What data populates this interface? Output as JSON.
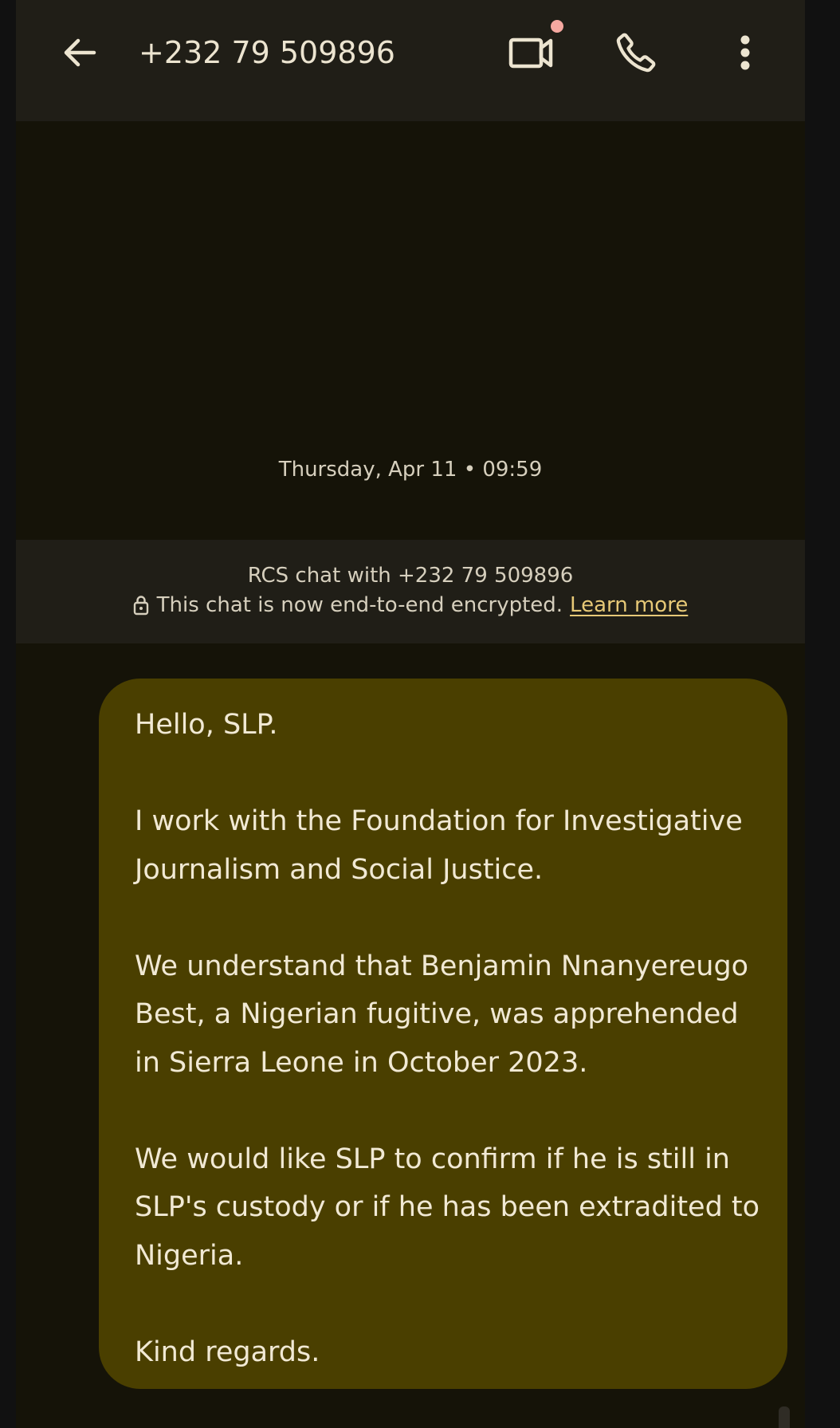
{
  "header": {
    "title": "+232 79 509896",
    "icons": [
      "back-arrow-icon",
      "video-call-icon",
      "phone-icon",
      "more-vert-icon"
    ],
    "video_badge_color": "#f5a8a0"
  },
  "conversation": {
    "timestamp": "Thursday, Apr 11 • 09:59",
    "rcs_banner": {
      "line1": "RCS chat with +232 79 509896",
      "line2": "This chat is now end-to-end encrypted.",
      "link_label": "Learn more"
    },
    "message": {
      "text": "Hello, SLP.\n\nI work with the Foundation for Investigative Journalism and Social Justice.\n\nWe understand that Benjamin Nnanyereugo Best, a Nigerian fugitive, was apprehended in Sierra Leone in October 2023.\n\nWe would like SLP to confirm if he is still in SLP's custody or if he has been extradited to Nigeria.\n\nKind regards."
    }
  },
  "colors": {
    "header_bg": "#201e17",
    "chat_bg": "#151308",
    "bubble_bg": "#4a3f00",
    "text": "#ece4d0",
    "link": "#e7c977"
  }
}
